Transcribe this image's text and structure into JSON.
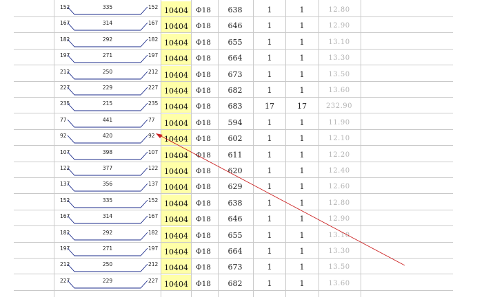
{
  "table": {
    "rows": [
      {
        "left": "152",
        "mid": "335",
        "right": "152",
        "code": "10404",
        "dia": "Φ18",
        "len": "638",
        "qa": "1",
        "qb": "1",
        "wt": "12.80"
      },
      {
        "left": "167",
        "mid": "314",
        "right": "167",
        "code": "10404",
        "dia": "Φ18",
        "len": "646",
        "qa": "1",
        "qb": "1",
        "wt": "12.90"
      },
      {
        "left": "182",
        "mid": "292",
        "right": "182",
        "code": "10404",
        "dia": "Φ18",
        "len": "655",
        "qa": "1",
        "qb": "1",
        "wt": "13.10"
      },
      {
        "left": "197",
        "mid": "271",
        "right": "197",
        "code": "10404",
        "dia": "Φ18",
        "len": "664",
        "qa": "1",
        "qb": "1",
        "wt": "13.30"
      },
      {
        "left": "212",
        "mid": "250",
        "right": "212",
        "code": "10404",
        "dia": "Φ18",
        "len": "673",
        "qa": "1",
        "qb": "1",
        "wt": "13.50"
      },
      {
        "left": "227",
        "mid": "229",
        "right": "227",
        "code": "10404",
        "dia": "Φ18",
        "len": "682",
        "qa": "1",
        "qb": "1",
        "wt": "13.60"
      },
      {
        "left": "235",
        "mid": "215",
        "right": "235",
        "code": "10404",
        "dia": "Φ18",
        "len": "683",
        "qa": "17",
        "qb": "17",
        "wt": "232.90"
      },
      {
        "left": "77",
        "mid": "441",
        "right": "77",
        "code": "10404",
        "dia": "Φ18",
        "len": "594",
        "qa": "1",
        "qb": "1",
        "wt": "11.90"
      },
      {
        "left": "92",
        "mid": "420",
        "right": "92",
        "code": "10404",
        "dia": "Φ18",
        "len": "602",
        "qa": "1",
        "qb": "1",
        "wt": "12.10"
      },
      {
        "left": "107",
        "mid": "398",
        "right": "107",
        "code": "10404",
        "dia": "Φ18",
        "len": "611",
        "qa": "1",
        "qb": "1",
        "wt": "12.20"
      },
      {
        "left": "122",
        "mid": "377",
        "right": "122",
        "code": "10404",
        "dia": "Φ18",
        "len": "620",
        "qa": "1",
        "qb": "1",
        "wt": "12.40"
      },
      {
        "left": "137",
        "mid": "356",
        "right": "137",
        "code": "10404",
        "dia": "Φ18",
        "len": "629",
        "qa": "1",
        "qb": "1",
        "wt": "12.60"
      },
      {
        "left": "152",
        "mid": "335",
        "right": "152",
        "code": "10404",
        "dia": "Φ18",
        "len": "638",
        "qa": "1",
        "qb": "1",
        "wt": "12.80"
      },
      {
        "left": "167",
        "mid": "314",
        "right": "167",
        "code": "10404",
        "dia": "Φ18",
        "len": "646",
        "qa": "1",
        "qb": "1",
        "wt": "12.90"
      },
      {
        "left": "182",
        "mid": "292",
        "right": "182",
        "code": "10404",
        "dia": "Φ18",
        "len": "655",
        "qa": "1",
        "qb": "1",
        "wt": "13.10"
      },
      {
        "left": "197",
        "mid": "271",
        "right": "197",
        "code": "10404",
        "dia": "Φ18",
        "len": "664",
        "qa": "1",
        "qb": "1",
        "wt": "13.30"
      },
      {
        "left": "212",
        "mid": "250",
        "right": "212",
        "code": "10404",
        "dia": "Φ18",
        "len": "673",
        "qa": "1",
        "qb": "1",
        "wt": "13.50"
      },
      {
        "left": "227",
        "mid": "229",
        "right": "227",
        "code": "10404",
        "dia": "Φ18",
        "len": "682",
        "qa": "1",
        "qb": "1",
        "wt": "13.60"
      }
    ]
  },
  "colors": {
    "code_highlight": "#ffffa8",
    "shape_line": "#1a2a8a",
    "arrow": "#cc2222",
    "weight_text": "#b5b5b5"
  },
  "icons": {
    "bar_shape": "bent-bar-shape-icon",
    "annotation": "red-arrow-annotation"
  }
}
